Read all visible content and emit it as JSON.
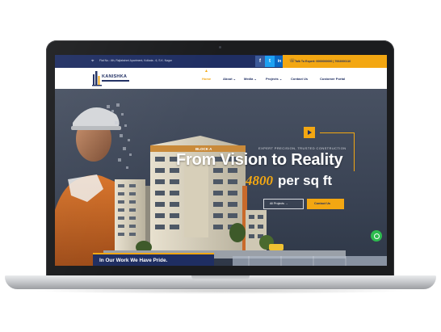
{
  "topbar": {
    "address": "Flat No.: 4th, Rajlakshmi Apartment, Kolkata - 6, S.K. Nagar",
    "social": [
      {
        "icon": "facebook-icon",
        "glyph": "f"
      },
      {
        "icon": "twitter-icon",
        "glyph": "t"
      },
      {
        "icon": "linkedin-icon",
        "glyph": "in"
      }
    ],
    "phone": "Talk To Expert: 0000000000 | 7002000110"
  },
  "brand": {
    "name": "KANISHKA"
  },
  "nav": {
    "items": [
      {
        "label": "Home",
        "active": true
      },
      {
        "label": "About ⌄",
        "active": false
      },
      {
        "label": "Media ⌄",
        "active": false
      },
      {
        "label": "Projects ⌄",
        "active": false
      },
      {
        "label": "Contact Us",
        "active": false
      },
      {
        "label": "Customer Portal",
        "active": false
      }
    ]
  },
  "hero": {
    "tagline": "EXPERT PRECISION, TRUSTED CONSTRUCTION",
    "title": "From Vision to Reality",
    "price_number": "4800",
    "price_text": "per sq ft",
    "btn_secondary": "All Projects →",
    "btn_primary": "Contact Us",
    "building_sign": "BLOCK A"
  },
  "pride": {
    "text": "In Our Work We Have Pride."
  },
  "colors": {
    "navy": "#1f2e62",
    "accent": "#f3a712",
    "whatsapp": "#2dbb4f"
  }
}
